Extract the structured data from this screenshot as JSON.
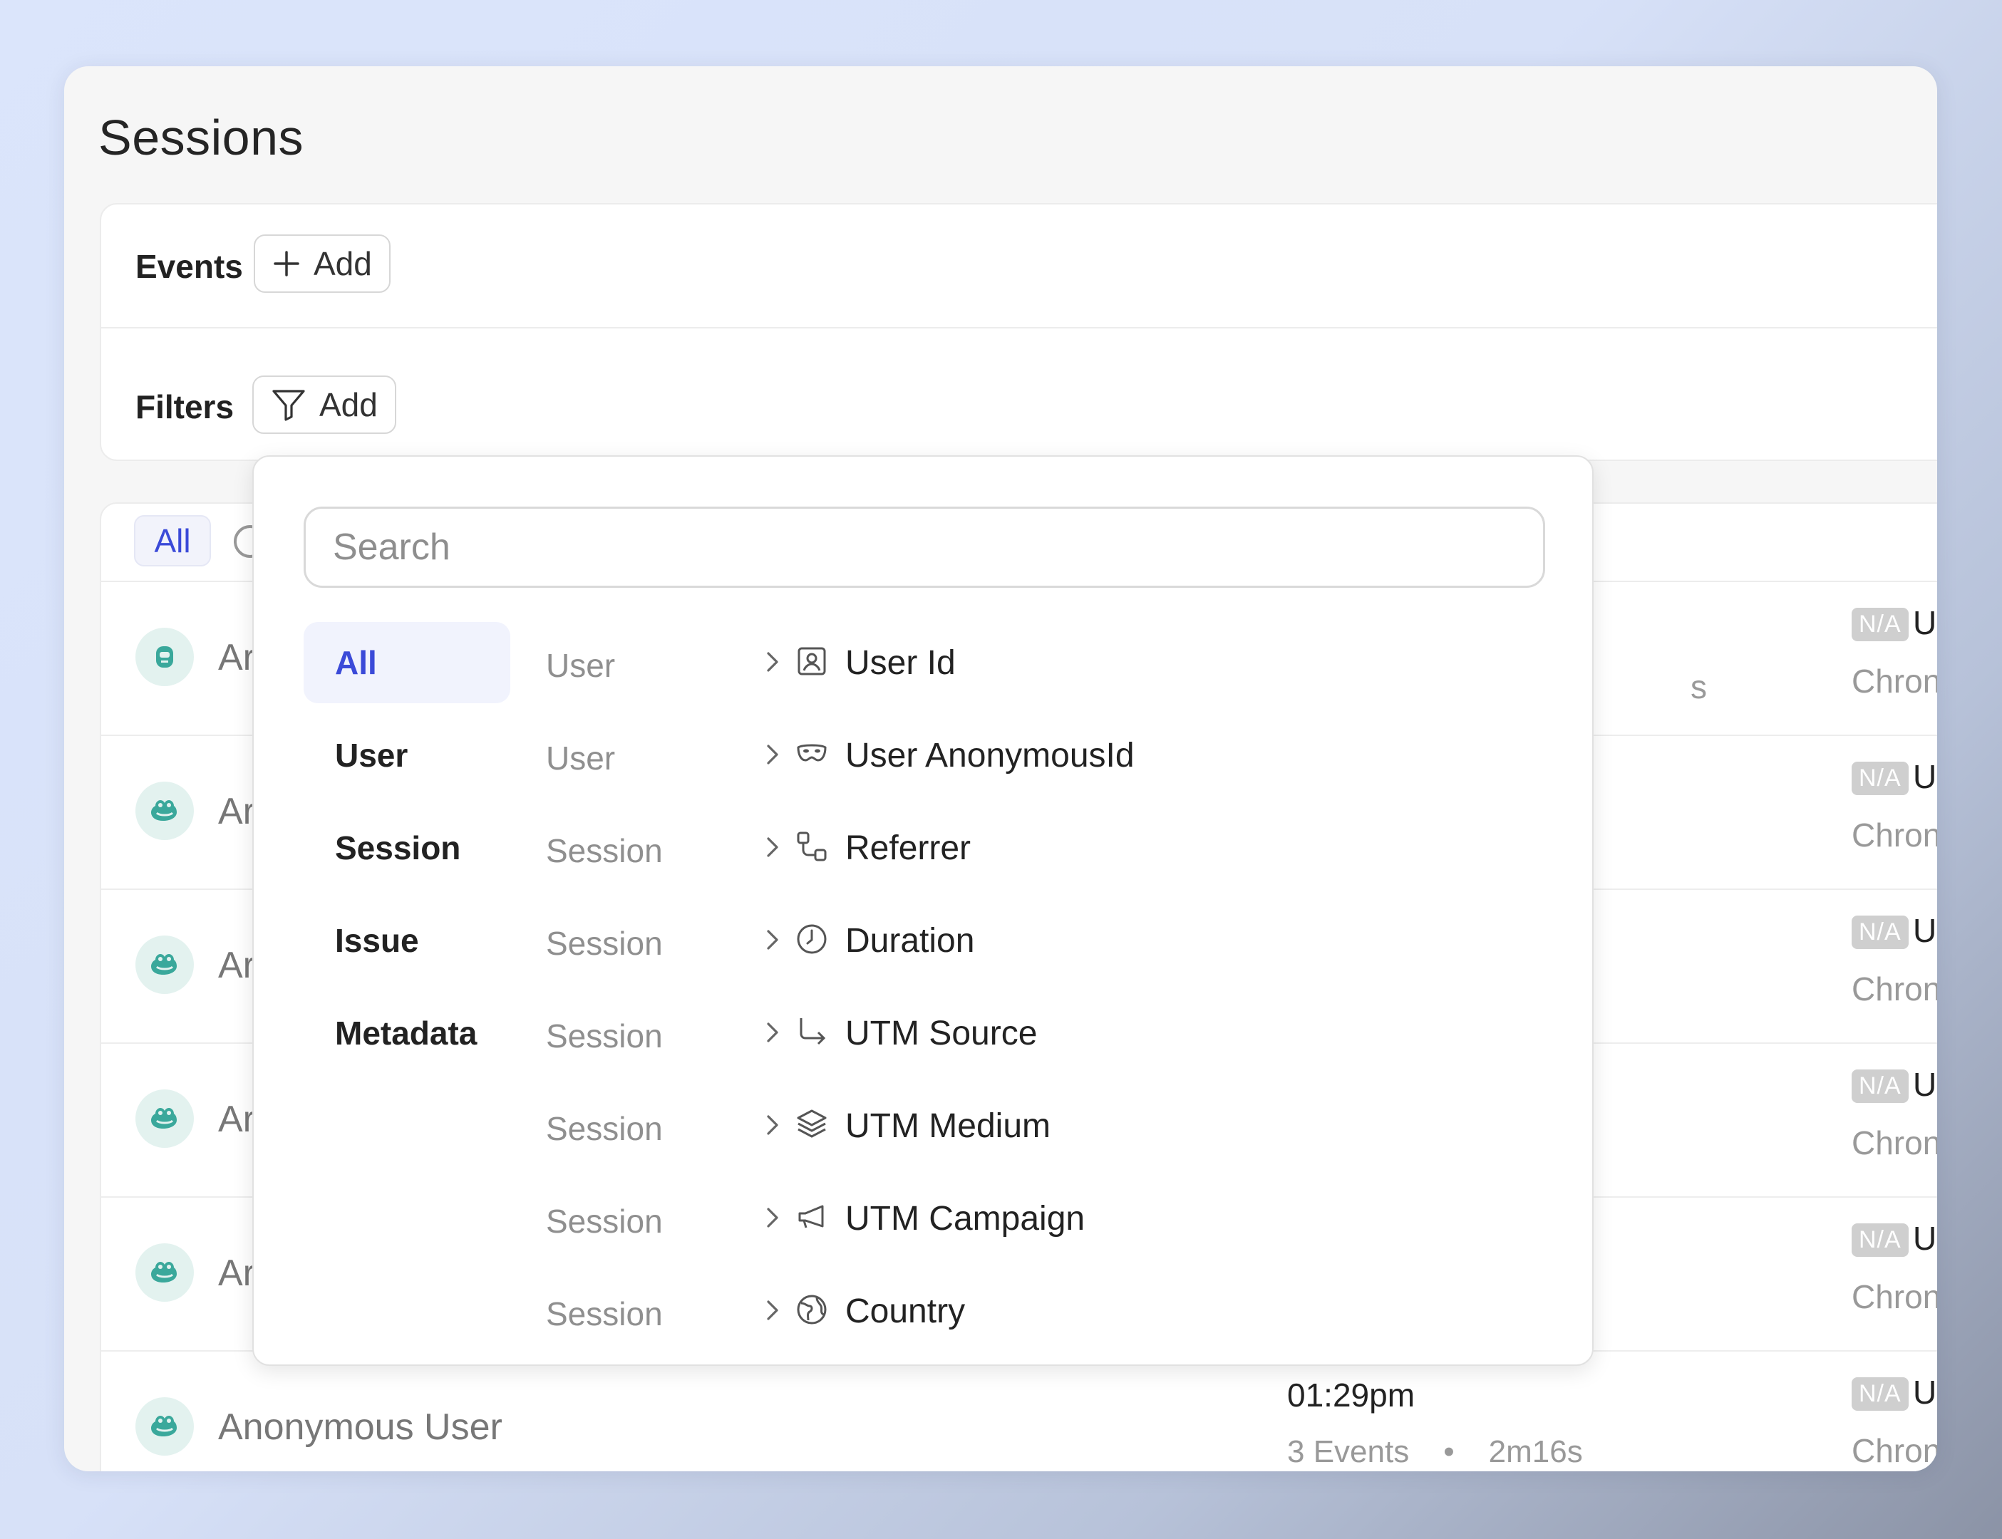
{
  "page": {
    "title": "Sessions"
  },
  "filters_panel": {
    "events_label": "Events",
    "events_add_label": "Add",
    "filters_label": "Filters",
    "filters_add_label": "Add"
  },
  "session_tabs": {
    "all_label": "All"
  },
  "sessions": [
    {
      "user": "Ar",
      "time": "",
      "events": "",
      "duration": "",
      "os_badge": "N/A",
      "os_initial": "U",
      "browser": "Chron",
      "avatar_icon": "robot-avatar-icon"
    },
    {
      "user": "Ar",
      "time": "",
      "events": "",
      "duration": "",
      "os_badge": "N/A",
      "os_initial": "U",
      "browser": "Chron",
      "avatar_icon": "frog-avatar-icon"
    },
    {
      "user": "Ar",
      "time": "",
      "events": "",
      "duration": "",
      "os_badge": "N/A",
      "os_initial": "U",
      "browser": "Chron",
      "avatar_icon": "frog-avatar-icon"
    },
    {
      "user": "Ar",
      "time": "",
      "events": "",
      "duration": "",
      "os_badge": "N/A",
      "os_initial": "U",
      "browser": "Chron",
      "avatar_icon": "frog-avatar-icon"
    },
    {
      "user": "Ar",
      "time": "",
      "events": "",
      "duration": "",
      "os_badge": "N/A",
      "os_initial": "U",
      "browser": "Chron",
      "avatar_icon": "frog-avatar-icon"
    },
    {
      "user": "Anonymous User",
      "time": "01:29pm",
      "events": "3 Events",
      "separator": "•",
      "duration": "2m16s",
      "os_badge": "N/A",
      "os_initial": "U",
      "browser": "Chron",
      "avatar_icon": "frog-avatar-icon"
    }
  ],
  "first_row_partial_text": "s",
  "filter_dropdown": {
    "search_placeholder": "Search",
    "categories": [
      "All",
      "User",
      "Session",
      "Issue",
      "Metadata"
    ],
    "active_category": "All",
    "properties": [
      {
        "group": "User",
        "label": "User Id",
        "icon": "user-id-icon"
      },
      {
        "group": "User",
        "label": "User AnonymousId",
        "icon": "mask-icon"
      },
      {
        "group": "Session",
        "label": "Referrer",
        "icon": "referrer-icon"
      },
      {
        "group": "Session",
        "label": "Duration",
        "icon": "clock-icon"
      },
      {
        "group": "Session",
        "label": "UTM Source",
        "icon": "arrow-corner-icon"
      },
      {
        "group": "Session",
        "label": "UTM Medium",
        "icon": "layers-icon"
      },
      {
        "group": "Session",
        "label": "UTM Campaign",
        "icon": "megaphone-icon"
      },
      {
        "group": "Session",
        "label": "Country",
        "icon": "globe-icon"
      }
    ]
  },
  "colors": {
    "accent": "#3b4ad8",
    "avatar_bg": "#e3f2ef",
    "avatar_icon": "#3aa89b",
    "badge_bg": "#cfcfcf"
  }
}
